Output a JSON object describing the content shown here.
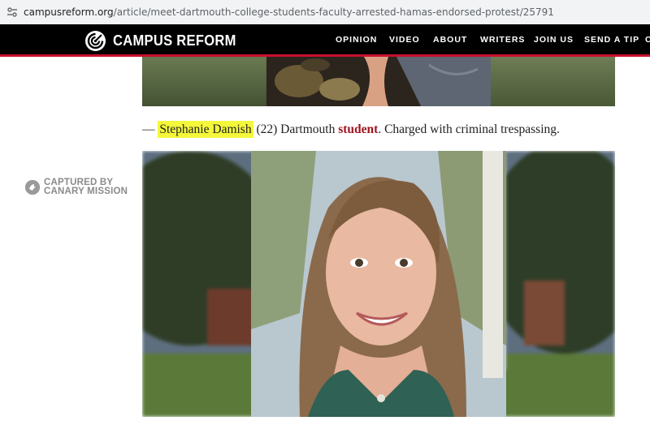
{
  "browser": {
    "url_domain": "campusreform.org",
    "url_path": "/article/meet-dartmouth-college-students-faculty-arrested-hamas-endorsed-protest/25791"
  },
  "site": {
    "logo_text": "CAMPUS REFORM",
    "nav": [
      "OPINION",
      "VIDEO",
      "ABOUT",
      "WRITERS",
      "JOIN US",
      "SEND A TIP"
    ],
    "brand_color": "#c8102e"
  },
  "article": {
    "caption": {
      "dash": "— ",
      "name": "Stephanie Damish",
      "age": " (22) Dartmouth ",
      "keyword": "student",
      "rest": ". Charged with criminal trespassing."
    },
    "badge": {
      "line1": "CAPTURED BY",
      "line2": "CANARY MISSION"
    }
  }
}
